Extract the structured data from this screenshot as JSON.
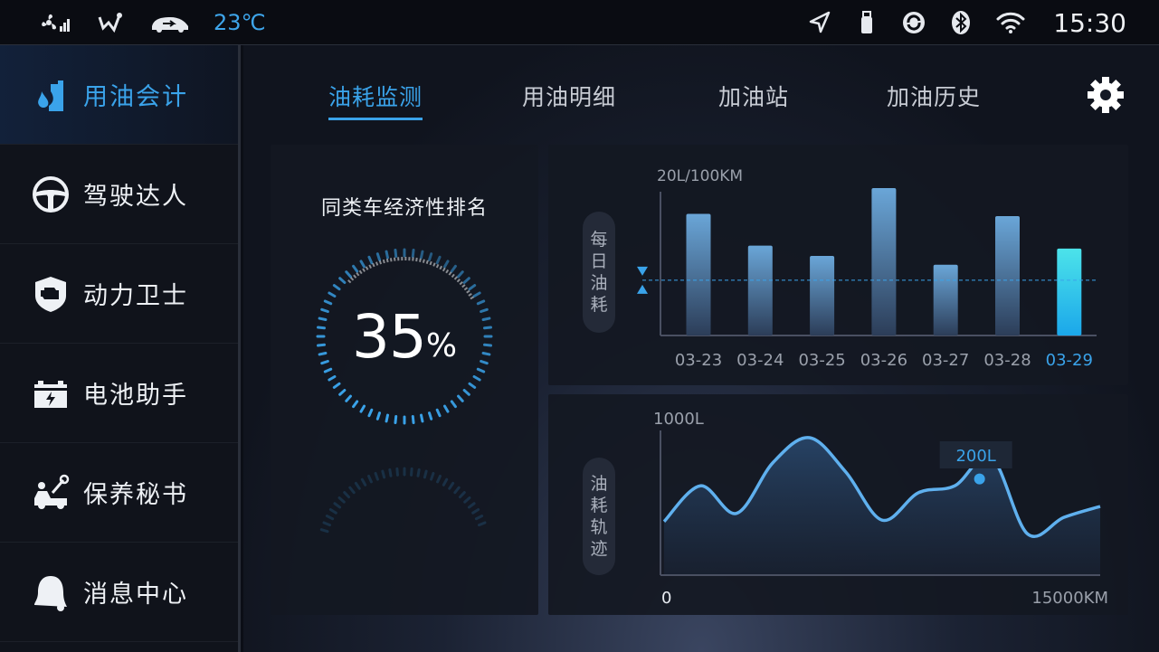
{
  "status_bar": {
    "left_icons": [
      "fan-signal-icon",
      "wind-icon",
      "car-recirculation-icon"
    ],
    "temperature": "23℃",
    "right_icons": [
      "navigation-icon",
      "usb-icon",
      "sync-icon",
      "bluetooth-icon",
      "wifi-icon"
    ],
    "time": "15:30"
  },
  "sidebar": {
    "items": [
      {
        "label": "用油会计",
        "icon": "fuel-drop-icon",
        "active": true
      },
      {
        "label": "驾驶达人",
        "icon": "steering-wheel-icon",
        "active": false
      },
      {
        "label": "动力卫士",
        "icon": "engine-shield-icon",
        "active": false
      },
      {
        "label": "电池助手",
        "icon": "battery-icon",
        "active": false
      },
      {
        "label": "保养秘书",
        "icon": "maintenance-car-icon",
        "active": false
      },
      {
        "label": "消息中心",
        "icon": "bell-icon",
        "active": false
      }
    ]
  },
  "tabs": [
    {
      "label": "油耗监测",
      "active": true
    },
    {
      "label": "用油明细",
      "active": false
    },
    {
      "label": "加油站",
      "active": false
    },
    {
      "label": "加油历史",
      "active": false
    }
  ],
  "settings_icon": "gear-icon",
  "ranking": {
    "title": "同类车经济性排名",
    "value": "35",
    "unit": "%",
    "percent": 35
  },
  "colors": {
    "accent": "#3aa3ea",
    "highlight_bar": "#22c8ee",
    "line": "#5fb0ee"
  },
  "chart_data": [
    {
      "type": "bar",
      "vertical_label": [
        "每",
        "日",
        "油",
        "耗"
      ],
      "ymax_label": "20L/100KM",
      "ylim": [
        0,
        20
      ],
      "categories": [
        "03-23",
        "03-24",
        "03-25",
        "03-26",
        "03-27",
        "03-28",
        "03-29"
      ],
      "values": [
        16.5,
        12.2,
        10.8,
        20.0,
        9.6,
        16.2,
        11.8
      ],
      "highlight_category": "03-29",
      "average_line": 7.5
    },
    {
      "type": "line",
      "vertical_label": [
        "油",
        "耗",
        "轨",
        "迹"
      ],
      "ymax_label": "1000L",
      "xmin_label": "0",
      "xmax_label": "15000KM",
      "xlim": [
        0,
        15000
      ],
      "ylim": [
        0,
        1000
      ],
      "x": [
        0,
        1250,
        2500,
        3750,
        5000,
        6250,
        7500,
        8750,
        10000,
        11250,
        12500,
        13750,
        15000
      ],
      "y": [
        390,
        650,
        450,
        820,
        1000,
        750,
        400,
        600,
        650,
        860,
        300,
        420,
        500
      ],
      "marker": {
        "x": 10850,
        "y": 700,
        "label": "200L"
      }
    }
  ]
}
